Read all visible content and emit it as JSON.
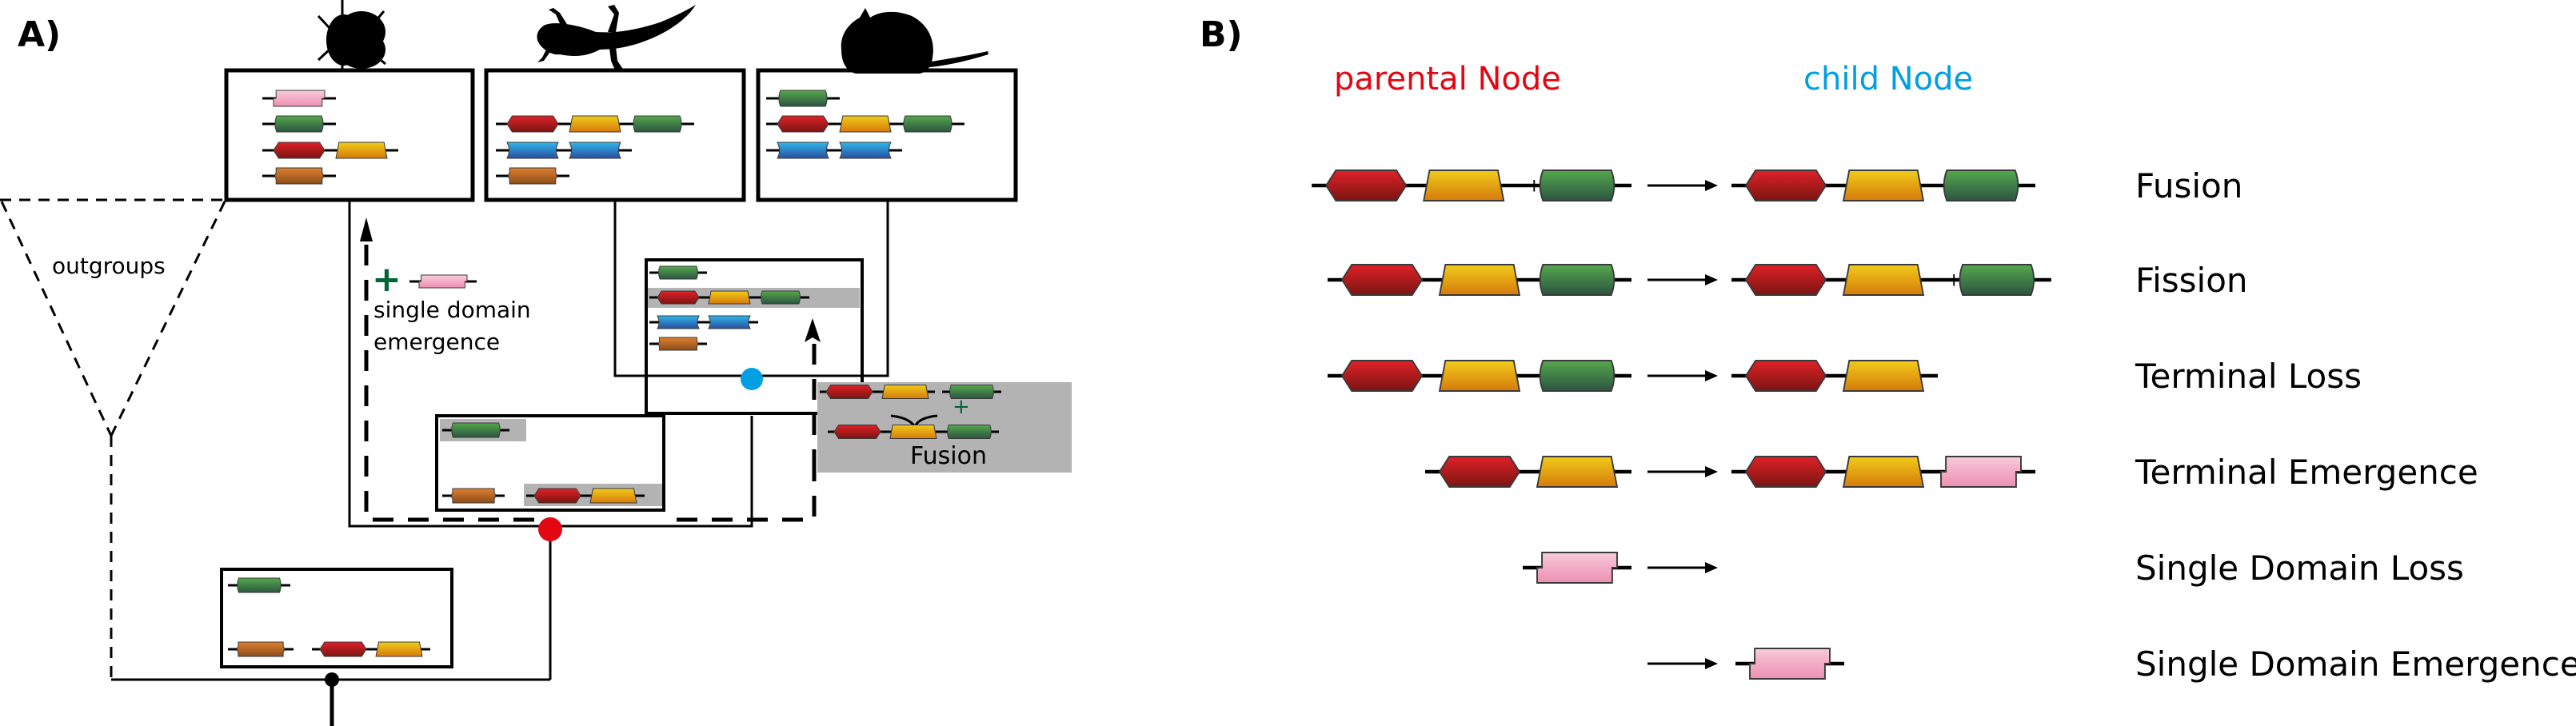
{
  "panel_a": {
    "label": "A)",
    "outgroups_label": "outgroups",
    "single_domain_emergence": {
      "line1": "single domain",
      "line2": "emergence",
      "plus_symbol": "+",
      "domain": "pink"
    },
    "fusion_inset": {
      "label": "Fusion",
      "plus_symbol": "+",
      "before": [
        "red",
        "yellow",
        "+",
        "green"
      ],
      "after": [
        "red",
        "yellow",
        "green"
      ]
    },
    "species": [
      {
        "name": "fly",
        "icon": "fly-silhouette-icon",
        "rows": [
          [
            "pink"
          ],
          [
            "green"
          ],
          [
            "red",
            "yellow"
          ],
          [
            "orange"
          ]
        ]
      },
      {
        "name": "lizard",
        "icon": "lizard-silhouette-icon",
        "rows": [
          [
            "red",
            "yellow",
            "green"
          ],
          [
            "blue",
            "blue"
          ],
          [
            "orange"
          ]
        ]
      },
      {
        "name": "mouse",
        "icon": "mouse-silhouette-icon",
        "rows": [
          [
            "green"
          ],
          [
            "red",
            "yellow",
            "green"
          ],
          [
            "blue",
            "blue"
          ]
        ]
      }
    ],
    "ancestor_nodes": [
      {
        "id": "lizard-mouse-ancestor",
        "node_color": "blue",
        "rows": [
          [
            "green"
          ],
          [
            "red",
            "yellow",
            "green"
          ],
          [
            "blue",
            "blue"
          ],
          [
            "orange"
          ]
        ],
        "highlighted_rows": [
          1
        ]
      },
      {
        "id": "bilateria-ancestor",
        "node_color": "red",
        "rows": [
          [
            "green"
          ],
          [
            "orange",
            "red",
            "yellow"
          ]
        ],
        "highlighted": [
          "green",
          "red-yellow"
        ]
      },
      {
        "id": "root",
        "node_color": "black",
        "rows": [
          [
            "green"
          ],
          [
            "orange",
            "red",
            "yellow"
          ]
        ]
      }
    ]
  },
  "panel_b": {
    "label": "B)",
    "parental_header": "parental Node",
    "child_header": "child Node",
    "events": [
      {
        "label": "Fusion",
        "parent": [
          "red",
          "yellow",
          "+",
          "green"
        ],
        "child": [
          "red",
          "yellow",
          "green"
        ]
      },
      {
        "label": "Fission",
        "parent": [
          "red",
          "yellow",
          "green"
        ],
        "child": [
          "red",
          "yellow",
          "+",
          "green"
        ]
      },
      {
        "label": "Terminal Loss",
        "parent": [
          "red",
          "yellow",
          "green"
        ],
        "child": [
          "red",
          "yellow"
        ]
      },
      {
        "label": "Terminal Emergence",
        "parent": [
          "red",
          "yellow"
        ],
        "child": [
          "red",
          "yellow",
          "pink"
        ]
      },
      {
        "label": "Single Domain Loss",
        "parent": [
          "pink"
        ],
        "child": []
      },
      {
        "label": "Single Domain Emergence",
        "parent": [],
        "child": [
          "pink"
        ]
      }
    ]
  },
  "colors": {
    "parental": "#e30613",
    "child": "#009fe3",
    "node_blue": "#009fe3",
    "node_red": "#e30613",
    "highlight": "#b3b3b3",
    "plus_green": "#006633",
    "domain_red": [
      "#e02127",
      "#7a1512"
    ],
    "domain_yellow": [
      "#f0cc1a",
      "#d67a0c"
    ],
    "domain_green": [
      "#56a84c",
      "#2b5442"
    ],
    "domain_blue": [
      "#2fb6ec",
      "#2a4f9e"
    ],
    "domain_orange": [
      "#e07f30",
      "#8a4d1a"
    ],
    "domain_pink": [
      "#f8cbda",
      "#ec8fb1"
    ]
  }
}
